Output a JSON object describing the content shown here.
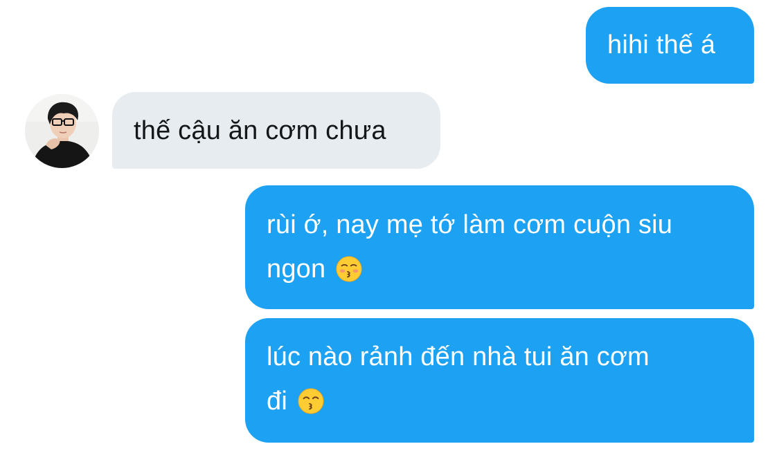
{
  "conversation": {
    "messages": [
      {
        "sender": "self",
        "text": "hihi thế á"
      },
      {
        "sender": "other",
        "text": "thế cậu ăn cơm chưa"
      },
      {
        "sender": "self",
        "line1": "rùi ớ, nay mẹ tớ làm cơm cuộn siu",
        "line2": "ngon",
        "emoji": "kissing-face-with-closed-eyes-icon"
      },
      {
        "sender": "self",
        "line1": "lúc nào rảnh đến nhà tui ăn cơm",
        "line2": "đi",
        "emoji": "kissing-face-with-smiling-eyes-icon"
      }
    ]
  },
  "colors": {
    "sent_bubble": "#1da1f2",
    "received_bubble": "#e6ecf0",
    "sent_text": "#ffffff",
    "received_text": "#14171a"
  }
}
